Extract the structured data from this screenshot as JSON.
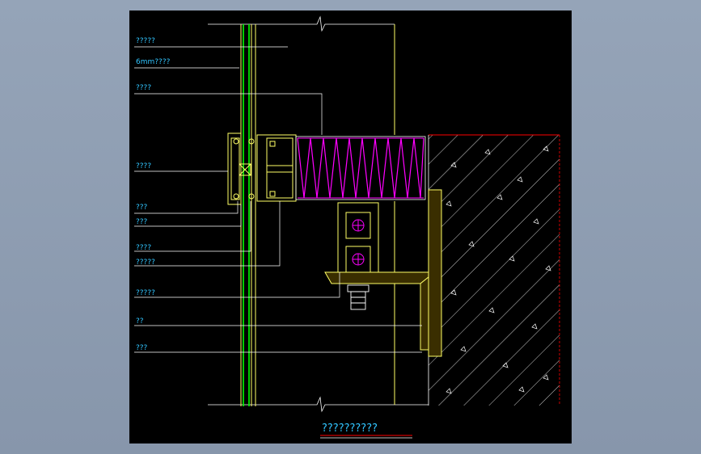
{
  "drawing": {
    "title": "??????????",
    "labels": [
      {
        "id": "l1",
        "text": "?????"
      },
      {
        "id": "l2",
        "text": "6mm????"
      },
      {
        "id": "l3",
        "text": "????"
      },
      {
        "id": "l4",
        "text": "????"
      },
      {
        "id": "l5",
        "text": "???"
      },
      {
        "id": "l6",
        "text": "???"
      },
      {
        "id": "l7",
        "text": "????"
      },
      {
        "id": "l8",
        "text": "?????"
      },
      {
        "id": "l9",
        "text": "?????"
      },
      {
        "id": "l10",
        "text": "??"
      },
      {
        "id": "l11",
        "text": "???"
      }
    ]
  },
  "colors": {
    "background": "#000000",
    "label_text": "#31c5ff",
    "frame_yellow": "#ffff66",
    "glass_green": "#00ff00",
    "insulation_magenta": "#ff00ff",
    "wall_red": "#ff0000",
    "leader_white": "#ffffff"
  }
}
